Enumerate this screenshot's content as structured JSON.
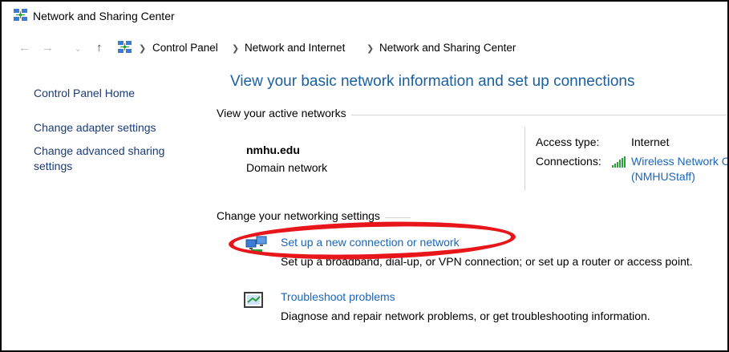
{
  "window": {
    "title": "Network and Sharing Center"
  },
  "address_bar": {
    "breadcrumbs": [
      "Control Panel",
      "Network and Internet",
      "Network and Sharing Center"
    ]
  },
  "left_nav": {
    "home": "Control Panel Home",
    "items": [
      "Change adapter settings",
      "Change advanced sharing",
      "settings"
    ]
  },
  "main": {
    "heading": "View your basic network information and set up connections",
    "active_networks_label": "View your active networks",
    "network": {
      "name": "nmhu.edu",
      "type": "Domain network",
      "access_type_label": "Access type:",
      "access_type_value": "Internet",
      "connections_label": "Connections:",
      "connection_name": "Wireless Network C",
      "connection_ssid": "(NMHUStaff)"
    },
    "change_settings_label": "Change your networking settings",
    "tasks": [
      {
        "title": "Set up a new connection or network",
        "desc": "Set up a broadband, dial-up, or VPN connection; or set up a router or access point."
      },
      {
        "title": "Troubleshoot problems",
        "desc": "Diagnose and repair network problems, or get troubleshooting information."
      }
    ]
  },
  "colors": {
    "heading": "#1a5fa0",
    "link": "#1a66b8",
    "nav_link": "#1a3b78",
    "highlight_ellipse": "#e8161a",
    "signal_bars": "#2e9e3a"
  },
  "icons": {
    "title": "network-center-icon",
    "address": "network-center-icon",
    "signal": "wifi-signal-icon",
    "task1": "new-connection-icon",
    "task2": "troubleshoot-icon"
  }
}
